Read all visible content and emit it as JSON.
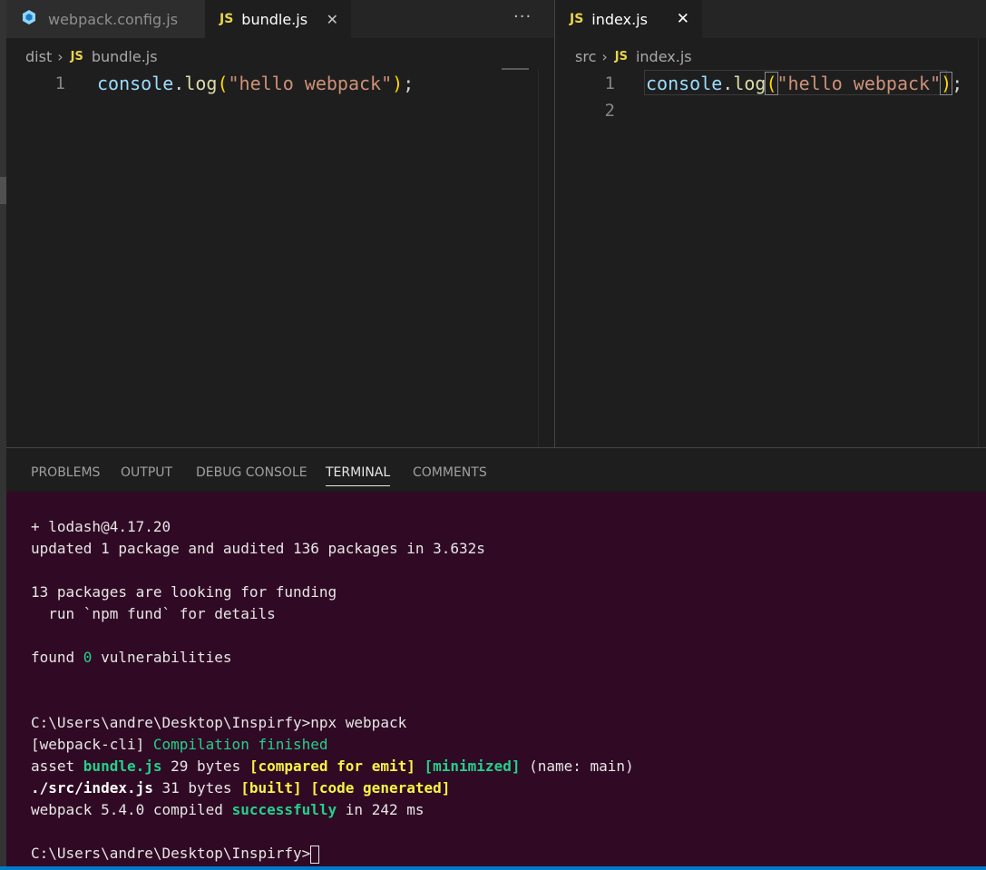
{
  "left_editor": {
    "tabs": [
      {
        "label": "webpack.config.js",
        "icon": "webpack-cube-icon",
        "active": false
      },
      {
        "label": "bundle.js",
        "icon": "js-icon",
        "active": true
      }
    ],
    "more_label": "···",
    "close_label": "✕",
    "breadcrumb": {
      "folder": "dist",
      "file": "bundle.js",
      "badge": "JS"
    },
    "lines": [
      {
        "number": "1",
        "tokens": {
          "obj": "console",
          "dot": ".",
          "fn": "log",
          "open": "(",
          "str": "\"hello webpack\"",
          "close": ")",
          "semi": ";"
        }
      }
    ]
  },
  "right_editor": {
    "tab": {
      "label": "index.js",
      "badge": "JS",
      "active": true
    },
    "close_label": "✕",
    "breadcrumb": {
      "folder": "src",
      "file": "index.js",
      "badge": "JS"
    },
    "lines": [
      {
        "number": "1",
        "tokens": {
          "obj": "console",
          "dot": ".",
          "fn": "log",
          "open": "(",
          "str": "\"hello webpack\"",
          "close": ")",
          "semi": ";"
        }
      },
      {
        "number": "2"
      }
    ]
  },
  "panel": {
    "tabs": [
      "PROBLEMS",
      "OUTPUT",
      "DEBUG CONSOLE",
      "TERMINAL",
      "COMMENTS"
    ],
    "active_tab": "TERMINAL"
  },
  "terminal": {
    "l1": "+ lodash@4.17.20",
    "l2": "updated 1 package and audited 136 packages in 3.632s",
    "l3": "13 packages are looking for funding",
    "l4": "  run `npm fund` for details",
    "l5a": "found ",
    "l5b": "0",
    "l5c": " vulnerabilities",
    "l6": "C:\\Users\\andre\\Desktop\\Inspirfy>npx webpack",
    "l7a": "[webpack-cli] ",
    "l7b": "Compilation finished",
    "l8a": "asset ",
    "l8b": "bundle.js",
    "l8c": " 29 bytes ",
    "l8d": "[compared for emit]",
    "l8e": " ",
    "l8f": "[minimized]",
    "l8g": " (name: main)",
    "l9a": "./src/index.js",
    "l9b": " 31 bytes ",
    "l9c": "[built] [code generated]",
    "l10a": "webpack 5.4.0 compiled ",
    "l10b": "successfully",
    "l10c": " in 242 ms",
    "prompt": "C:\\Users\\andre\\Desktop\\Inspirfy>"
  },
  "colors": {
    "terminal_bg": "#300a24",
    "editor_bg": "#1e1e1e",
    "js_badge": "#e8d44d",
    "accent_blue": "#007acc"
  }
}
